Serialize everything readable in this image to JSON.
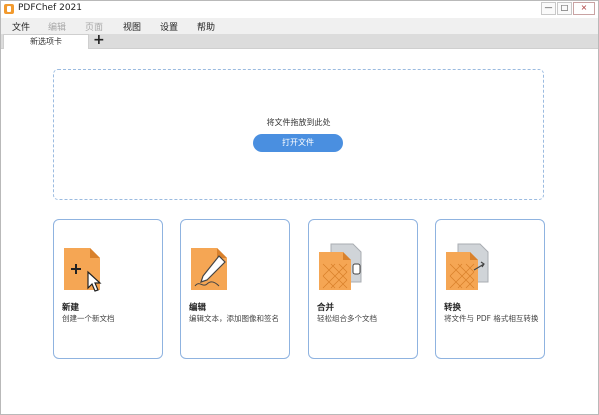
{
  "window": {
    "title": "PDFChef 2021",
    "min": "—",
    "max": "□",
    "close": "×"
  },
  "menu": [
    {
      "label": "文件",
      "disabled": false
    },
    {
      "label": "编辑",
      "disabled": true
    },
    {
      "label": "页面",
      "disabled": true
    },
    {
      "label": "视图",
      "disabled": false
    },
    {
      "label": "设置",
      "disabled": false
    },
    {
      "label": "帮助",
      "disabled": false
    }
  ],
  "tabs": {
    "active": "新选项卡",
    "add": "+"
  },
  "dropzone": {
    "text": "将文件拖放到此处",
    "button": "打开文件"
  },
  "cards": [
    {
      "title": "新建",
      "desc": "创建一个新文档",
      "icon": "new-document-icon"
    },
    {
      "title": "编辑",
      "desc": "编辑文本，添加图像和签名",
      "icon": "edit-document-icon"
    },
    {
      "title": "合并",
      "desc": "轻松组合多个文档",
      "icon": "merge-documents-icon"
    },
    {
      "title": "转换",
      "desc": "将文件与 PDF 格式相互转换",
      "icon": "convert-document-icon"
    }
  ],
  "colors": {
    "accent": "#4a8fe0",
    "doc": "#f5a654",
    "border": "#8fb3e0"
  }
}
